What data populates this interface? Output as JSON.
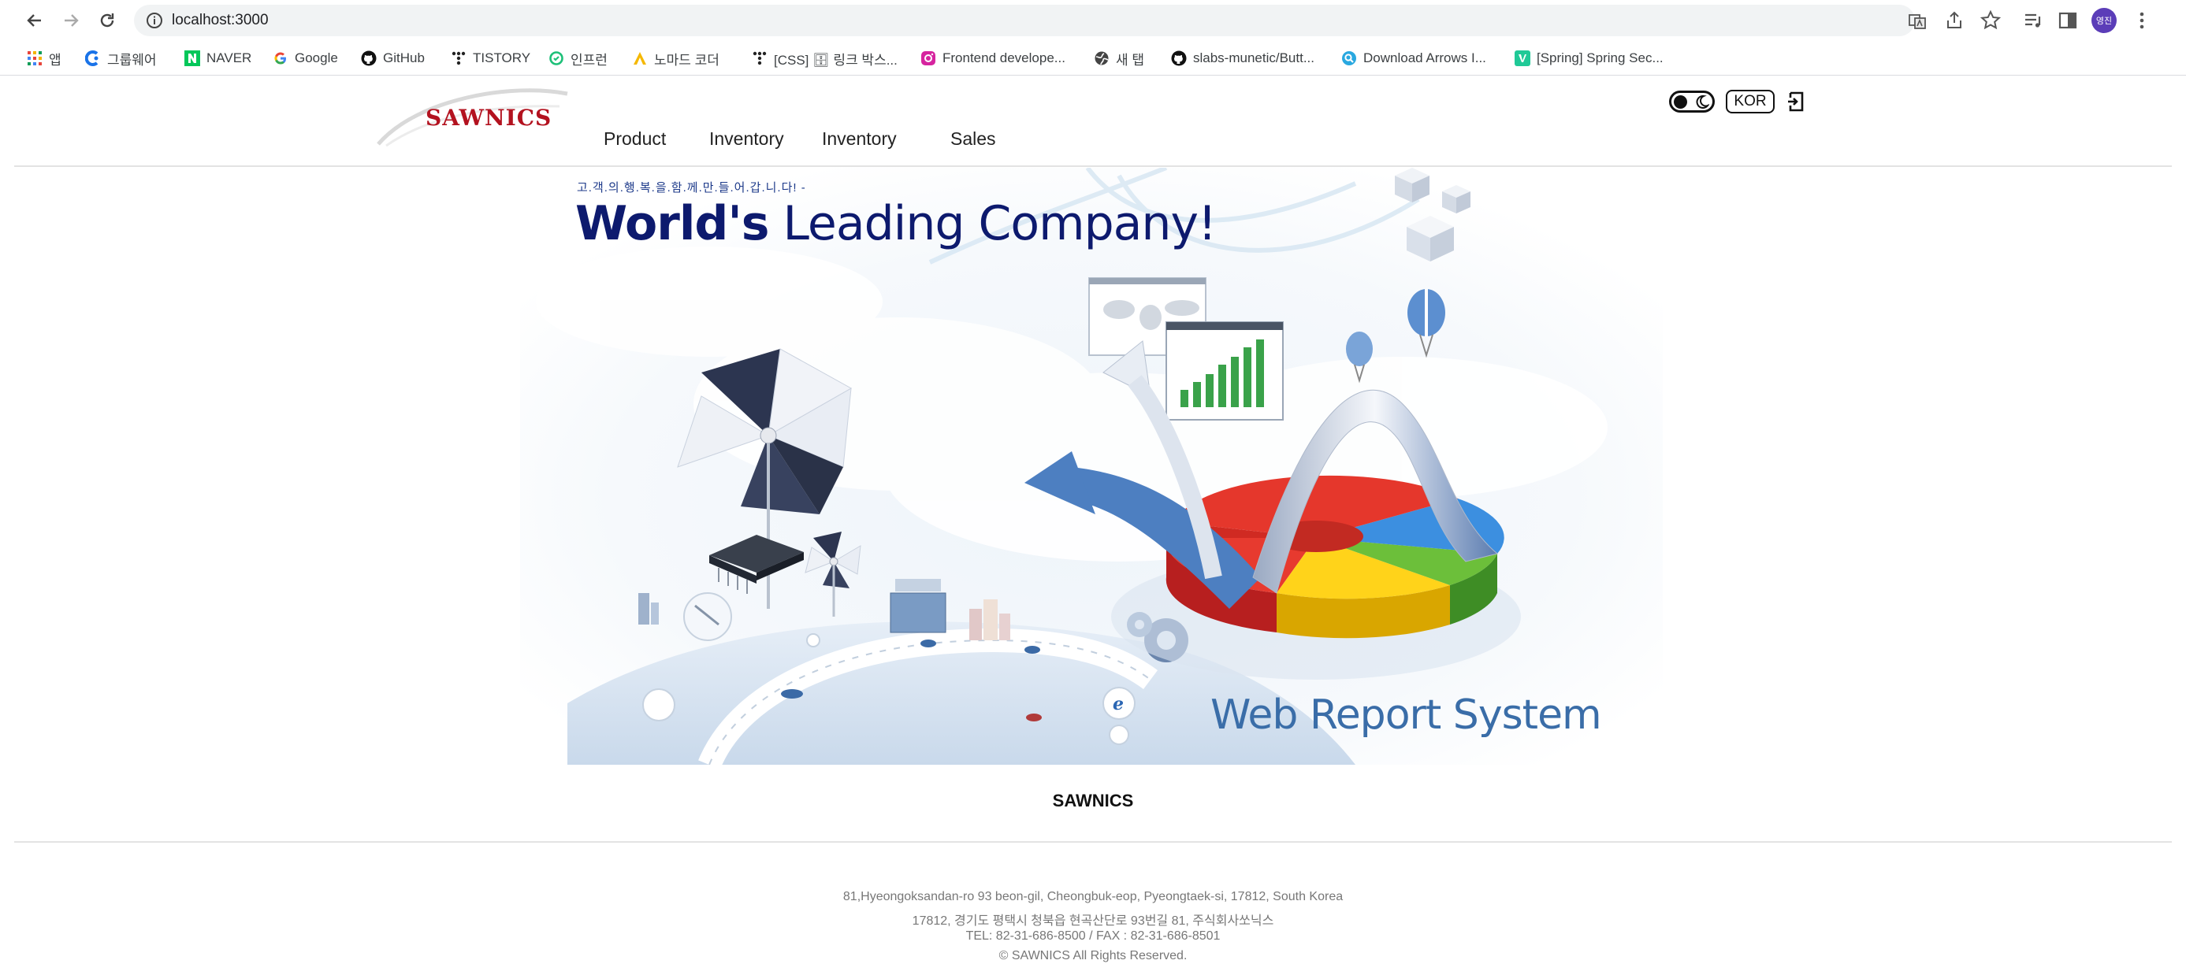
{
  "browser": {
    "url": "localhost:3000",
    "profile_initials": "영진",
    "bookmarks": [
      {
        "label": "앱",
        "icon": "apps-grid-icon"
      },
      {
        "label": "그룹웨어",
        "icon": "groupware-icon"
      },
      {
        "label": "NAVER",
        "icon": "naver-icon"
      },
      {
        "label": "Google",
        "icon": "google-icon"
      },
      {
        "label": "GitHub",
        "icon": "github-icon"
      },
      {
        "label": "TISTORY",
        "icon": "tistory-icon"
      },
      {
        "label": "인프런",
        "icon": "inflearn-icon"
      },
      {
        "label": "노마드 코더",
        "icon": "nomad-coder-icon"
      },
      {
        "label": "[CSS] 🗄 링크 박스...",
        "icon": "tistory-icon"
      },
      {
        "label": "Frontend develope...",
        "icon": "instagram-icon"
      },
      {
        "label": "새 탭",
        "icon": "globe-icon"
      },
      {
        "label": "slabs-munetic/Butt...",
        "icon": "github-icon"
      },
      {
        "label": "Download Arrows I...",
        "icon": "search-site-icon"
      },
      {
        "label": "[Spring] Spring Sec...",
        "icon": "velog-icon"
      }
    ]
  },
  "header": {
    "logo_text": "SAWNICS",
    "menu": [
      "Product",
      "Inventory",
      "Inventory",
      "Sales"
    ],
    "lang_label": "KOR"
  },
  "banner": {
    "slogan": "고.객.의.행.복.을.함.께.만.들.어.갑.니.다! -",
    "title_bold": "World's",
    "title_rest": "Leading Company!",
    "subtitle": "Web Report System"
  },
  "footer": {
    "company": "SAWNICS",
    "address_en": "81,Hyeongoksandan-ro 93 beon-gil, Cheongbuk-eop, Pyeongtaek-si, 17812, South Korea",
    "address_ko": "17812, 경기도 평택시 청북읍 현곡산단로 93번길 81, 주식회사쏘닉스",
    "contact": "TEL: 82-31-686-8500 / FAX : 82-31-686-8501",
    "copyright": "© SAWNICS All Rights Reserved."
  },
  "colors": {
    "logo_red": "#b3121f",
    "title_navy": "#0d1a6e",
    "subtitle_blue": "#3a6da8",
    "profile_purple": "#5b3db8"
  }
}
